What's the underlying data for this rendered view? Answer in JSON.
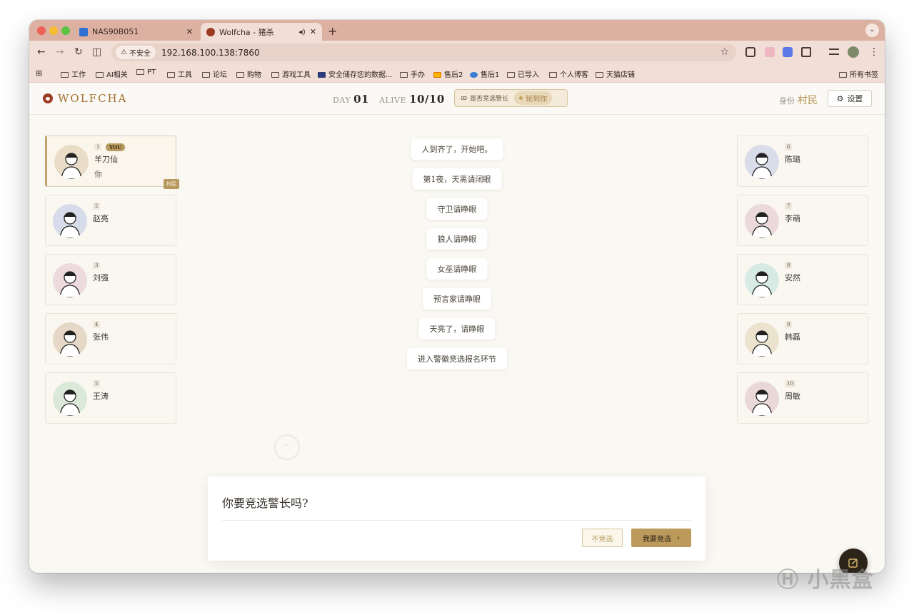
{
  "browser": {
    "tabs": [
      {
        "title": "NAS90B051",
        "active": false
      },
      {
        "title": "Wolfcha - 猪杀",
        "active": true
      }
    ],
    "address": {
      "security_label": "不安全",
      "url": "192.168.100.138:7860"
    },
    "bookmarks": [
      "工作",
      "AI相关",
      "PT",
      "工具",
      "论坛",
      "购物",
      "游戏工具",
      "安全储存您的数据...",
      "手办",
      "售后2",
      "售后1",
      "已导入",
      "个人博客",
      "天猫店铺"
    ],
    "all_bookmarks": "所有书签"
  },
  "app": {
    "logo": "WOLFCHA",
    "day_label": "DAY",
    "day_value": "01",
    "alive_label": "ALIVE",
    "alive_value": "10/10",
    "sheriff_question": "是否竞选警长",
    "turn_label": "轮到你",
    "identity_label": "身份",
    "identity_value": "村民",
    "settings_label": "设置"
  },
  "players_left": [
    {
      "num": "1",
      "name": "羊刀仙",
      "you": "YOU",
      "sub": "你",
      "role": "村民",
      "bg": "#e9ddc8"
    },
    {
      "num": "2",
      "name": "赵亮",
      "bg": "#d7dcea"
    },
    {
      "num": "3",
      "name": "刘强",
      "bg": "#eddadf"
    },
    {
      "num": "4",
      "name": "张伟",
      "bg": "#e6d8c6"
    },
    {
      "num": "5",
      "name": "王涛",
      "bg": "#dbe9d8"
    }
  ],
  "players_right": [
    {
      "num": "6",
      "name": "陈璐",
      "bg": "#d9dce9"
    },
    {
      "num": "7",
      "name": "李萌",
      "bg": "#ecd9dc"
    },
    {
      "num": "8",
      "name": "安然",
      "bg": "#d8eae4"
    },
    {
      "num": "9",
      "name": "韩磊",
      "bg": "#ece3cf"
    },
    {
      "num": "10",
      "name": "周敏",
      "bg": "#ead8d8"
    }
  ],
  "log": [
    "人到齐了，开始吧。",
    "第1夜，天黑请闭眼",
    "守卫请睁眼",
    "狼人请睁眼",
    "女巫请睁眼",
    "预言家请睁眼",
    "天亮了，请睁眼",
    "进入警徽竞选报名环节"
  ],
  "dialog": {
    "question": "你要竞选警长吗?",
    "decline": "不竞选",
    "accept": "我要竞选"
  },
  "watermark": "小黑盒"
}
